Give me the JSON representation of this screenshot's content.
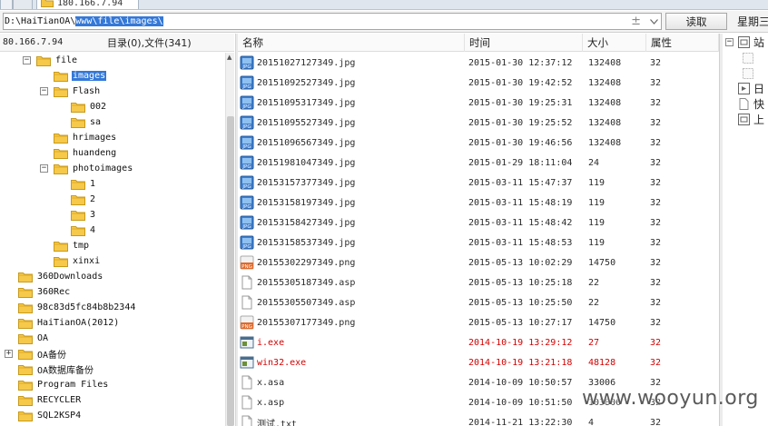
{
  "tabs": [
    {
      "label": ""
    },
    {
      "label": ""
    },
    {
      "label": "180.166.7.94"
    }
  ],
  "address": {
    "prefix": "D:\\HaiTianOA\\",
    "selected": "www\\file\\images\\",
    "plusminus": "±"
  },
  "read_button": "读取",
  "weekday": "星期三",
  "left_panel": {
    "ip": "80.166.7.94",
    "counts": "目录(0),文件(341)"
  },
  "tree": [
    {
      "label": "file",
      "toggle": "−",
      "selected": false
    },
    {
      "label": "images",
      "toggle": "",
      "selected": true
    },
    {
      "label": "Flash",
      "toggle": "−",
      "selected": false
    },
    {
      "label": "002",
      "toggle": "",
      "selected": false
    },
    {
      "label": "sa",
      "toggle": "",
      "selected": false
    },
    {
      "label": "hrimages",
      "toggle": "",
      "selected": false
    },
    {
      "label": "huandeng",
      "toggle": "",
      "selected": false
    },
    {
      "label": "photoimages",
      "toggle": "−",
      "selected": false
    },
    {
      "label": "1",
      "toggle": "",
      "selected": false
    },
    {
      "label": "2",
      "toggle": "",
      "selected": false
    },
    {
      "label": "3",
      "toggle": "",
      "selected": false
    },
    {
      "label": "4",
      "toggle": "",
      "selected": false
    },
    {
      "label": "tmp",
      "toggle": "",
      "selected": false
    },
    {
      "label": "xinxi",
      "toggle": "",
      "selected": false
    },
    {
      "label": "360Downloads",
      "toggle": "",
      "selected": false
    },
    {
      "label": "360Rec",
      "toggle": "",
      "selected": false
    },
    {
      "label": "98c83d5fc84b8b2344",
      "toggle": "",
      "selected": false
    },
    {
      "label": "HaiTianOA(2012)",
      "toggle": "",
      "selected": false
    },
    {
      "label": "OA",
      "toggle": "",
      "selected": false
    },
    {
      "label": "OA备份",
      "toggle": "+",
      "selected": false
    },
    {
      "label": "OA数据库备份",
      "toggle": "",
      "selected": false
    },
    {
      "label": "Program Files",
      "toggle": "",
      "selected": false
    },
    {
      "label": "RECYCLER",
      "toggle": "",
      "selected": false
    },
    {
      "label": "SQL2KSP4",
      "toggle": "",
      "selected": false
    }
  ],
  "file_columns": {
    "name": "名称",
    "time": "时间",
    "size": "大小",
    "attr": "属性"
  },
  "files": [
    {
      "icon": "jpg",
      "name": "20151027127349.jpg",
      "time": "2015-01-30 12:37:12",
      "size": "132408",
      "attr": "32",
      "red": false
    },
    {
      "icon": "jpg",
      "name": "20151092527349.jpg",
      "time": "2015-01-30 19:42:52",
      "size": "132408",
      "attr": "32",
      "red": false
    },
    {
      "icon": "jpg",
      "name": "20151095317349.jpg",
      "time": "2015-01-30 19:25:31",
      "size": "132408",
      "attr": "32",
      "red": false
    },
    {
      "icon": "jpg",
      "name": "20151095527349.jpg",
      "time": "2015-01-30 19:25:52",
      "size": "132408",
      "attr": "32",
      "red": false
    },
    {
      "icon": "jpg",
      "name": "20151096567349.jpg",
      "time": "2015-01-30 19:46:56",
      "size": "132408",
      "attr": "32",
      "red": false
    },
    {
      "icon": "jpg",
      "name": "20151981047349.jpg",
      "time": "2015-01-29 18:11:04",
      "size": "24",
      "attr": "32",
      "red": false
    },
    {
      "icon": "jpg",
      "name": "20153157377349.jpg",
      "time": "2015-03-11 15:47:37",
      "size": "119",
      "attr": "32",
      "red": false
    },
    {
      "icon": "jpg",
      "name": "20153158197349.jpg",
      "time": "2015-03-11 15:48:19",
      "size": "119",
      "attr": "32",
      "red": false
    },
    {
      "icon": "jpg",
      "name": "20153158427349.jpg",
      "time": "2015-03-11 15:48:42",
      "size": "119",
      "attr": "32",
      "red": false
    },
    {
      "icon": "jpg",
      "name": "20153158537349.jpg",
      "time": "2015-03-11 15:48:53",
      "size": "119",
      "attr": "32",
      "red": false
    },
    {
      "icon": "png",
      "name": "20155302297349.png",
      "time": "2015-05-13 10:02:29",
      "size": "14750",
      "attr": "32",
      "red": false
    },
    {
      "icon": "doc",
      "name": "20155305187349.asp",
      "time": "2015-05-13 10:25:18",
      "size": "22",
      "attr": "32",
      "red": false
    },
    {
      "icon": "doc",
      "name": "20155305507349.asp",
      "time": "2015-05-13 10:25:50",
      "size": "22",
      "attr": "32",
      "red": false
    },
    {
      "icon": "png",
      "name": "20155307177349.png",
      "time": "2015-05-13 10:27:17",
      "size": "14750",
      "attr": "32",
      "red": false
    },
    {
      "icon": "exe",
      "name": "i.exe",
      "time": "2014-10-19 13:29:12",
      "size": "27",
      "attr": "32",
      "red": true
    },
    {
      "icon": "exe",
      "name": "win32.exe",
      "time": "2014-10-19 13:21:18",
      "size": "48128",
      "attr": "32",
      "red": true
    },
    {
      "icon": "doc",
      "name": "x.asa",
      "time": "2014-10-09 10:50:57",
      "size": "33006",
      "attr": "32",
      "red": false
    },
    {
      "icon": "doc",
      "name": "x.asp",
      "time": "2014-10-09 10:51:50",
      "size": "103806",
      "attr": "32",
      "red": false
    },
    {
      "icon": "doc",
      "name": "测试.txt",
      "time": "2014-11-21 13:22:30",
      "size": "4",
      "attr": "32",
      "red": false
    }
  ],
  "right_panel": [
    {
      "label": "站",
      "toggle": "−"
    },
    {
      "label": "",
      "toggle": ""
    },
    {
      "label": "",
      "toggle": ""
    },
    {
      "label": "日",
      "toggle": ""
    },
    {
      "label": "快",
      "toggle": ""
    },
    {
      "label": "上",
      "toggle": ""
    }
  ],
  "watermark": "www.wooyun.org"
}
